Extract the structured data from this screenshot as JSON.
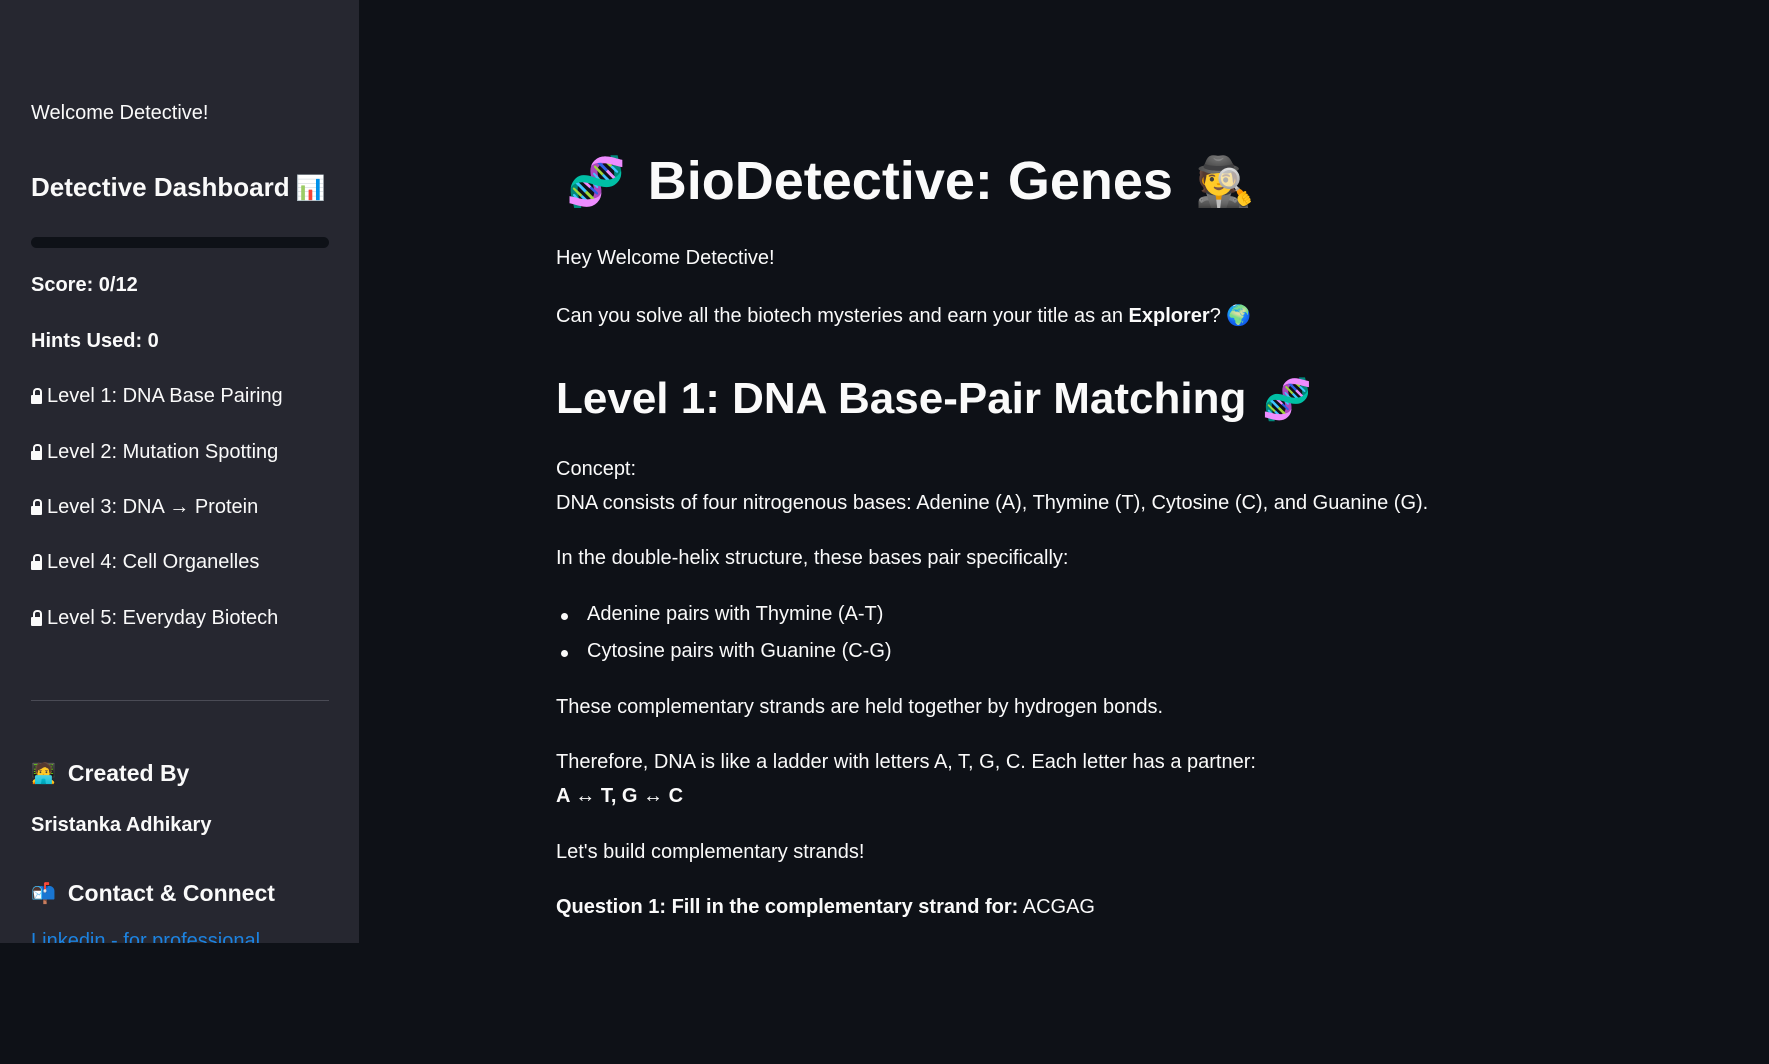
{
  "sidebar": {
    "welcome": "Welcome Detective!",
    "dashboard_title": "Detective Dashboard",
    "dashboard_emoji": "📊",
    "progress": 0,
    "score": "Score: 0/12",
    "hints": "Hints Used: 0",
    "levels": [
      "Level 1: DNA Base Pairing",
      "Level 2: Mutation Spotting",
      "Level 3: DNA → Protein",
      "Level 4: Cell Organelles",
      "Level 5: Everyday Biotech"
    ],
    "created_by_emoji": "🧑‍💻",
    "created_by": "Created By",
    "author": "Sristanka Adhikary",
    "contact_emoji": "📬",
    "contact": "Contact & Connect",
    "link_partial": "Linkedin - for professional"
  },
  "main": {
    "title_emoji_left": "🧬",
    "title": "BioDetective: Genes",
    "title_emoji_right": "🕵️",
    "greeting": "Hey Welcome Detective!",
    "intro_before": "Can you solve all the biotech mysteries and earn your title as an ",
    "intro_bold": "Explorer",
    "intro_after": "? 🌍",
    "level_heading": "Level 1: DNA Base-Pair Matching",
    "level_emoji": "🧬",
    "concept_label": "Concept:",
    "concept_text": "DNA consists of four nitrogenous bases: Adenine (A), Thymine (T), Cytosine (C), and Guanine (G).",
    "pairing_intro": "In the double-helix structure, these bases pair specifically:",
    "bullets": [
      "Adenine pairs with Thymine (A-T)",
      "Cytosine pairs with Guanine (C-G)"
    ],
    "hydrogen": "These complementary strands are held together by hydrogen bonds.",
    "ladder": "Therefore, DNA is like a ladder with letters A, T, G, C. Each letter has a partner:",
    "pairs_bold": "A ↔ T, G ↔ C",
    "lets_build": "Let's build complementary strands!",
    "question_bold": "Question 1: Fill in the complementary strand for:",
    "question_seq": "ACGAG"
  }
}
